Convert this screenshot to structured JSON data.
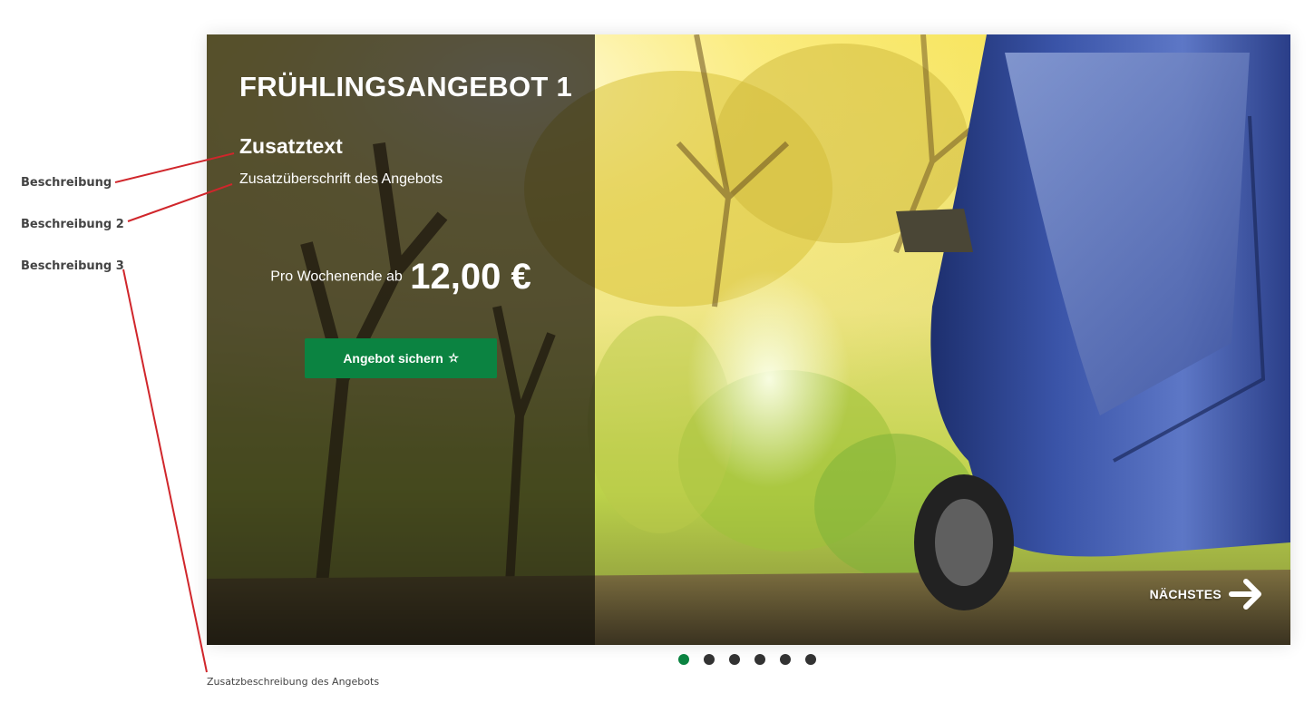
{
  "annotations": {
    "label_1": "Beschreibung",
    "label_2": "Beschreibung 2",
    "label_3": "Beschreibung 3",
    "footer": "Zusatzbeschreibung des Angebots",
    "line_color": "#d0262b"
  },
  "slide": {
    "title": "FRÜHLINGSANGEBOT 1",
    "subtitle": "Zusatztext",
    "description": "Zusatzüberschrift des Angebots",
    "price_prefix": "Pro Wochenende ab",
    "price": "12,00 €",
    "button_label": "Angebot sichern",
    "button_icon": "sparkle-star-icon",
    "next_label": "NÄCHSTES",
    "next_icon": "arrow-right-icon"
  },
  "pagination": {
    "count": 6,
    "active_index": 0,
    "active_color": "#0b8341",
    "inactive_color": "#333333"
  },
  "colors": {
    "accent": "#0b8341",
    "panel_overlay": "rgba(22,20,12,0.72)"
  }
}
